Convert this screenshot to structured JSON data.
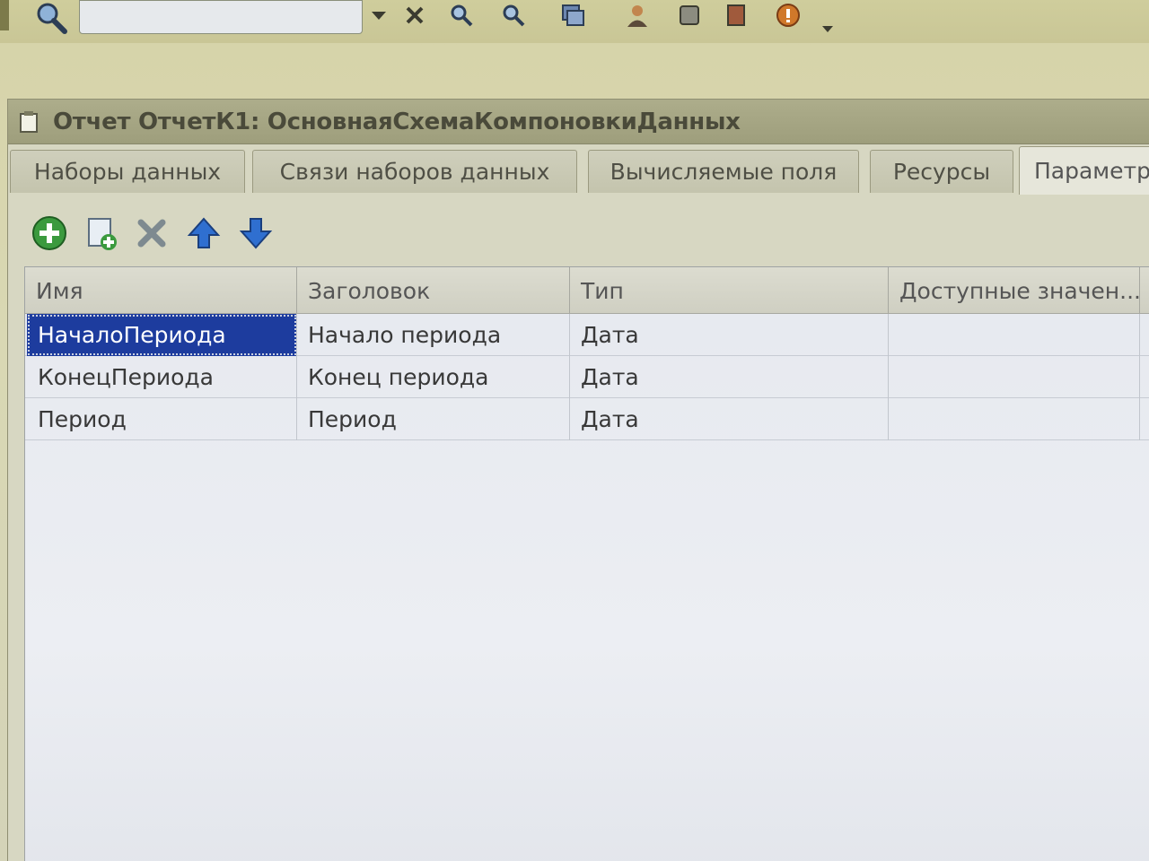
{
  "toolbar": {
    "search_value": "",
    "buttons": [
      "dropdown-arrow",
      "clear",
      "find-next",
      "find-previous",
      "windows",
      "user",
      "help-topics",
      "book",
      "info",
      "more"
    ]
  },
  "window": {
    "title": "Отчет ОтчетК1: ОсновнаяСхемаКомпоновкиДанных"
  },
  "tabs": [
    {
      "label": "Наборы данных"
    },
    {
      "label": "Связи наборов данных"
    },
    {
      "label": "Вычисляемые поля"
    },
    {
      "label": "Ресурсы"
    },
    {
      "label": "Параметры"
    }
  ],
  "active_tab": 4,
  "commands": [
    "add",
    "copy",
    "delete",
    "move-up",
    "move-down"
  ],
  "table": {
    "columns": [
      "Имя",
      "Заголовок",
      "Тип",
      "Доступные значен..."
    ],
    "rows": [
      {
        "name": "НачалоПериода",
        "title": "Начало периода",
        "type": "Дата",
        "values": ""
      },
      {
        "name": "КонецПериода",
        "title": "Конец периода",
        "type": "Дата",
        "values": ""
      },
      {
        "name": "Период",
        "title": "Период",
        "type": "Дата",
        "values": ""
      }
    ],
    "selected_row": 0
  },
  "colors": {
    "selection": "#1d3c9e",
    "add_green": "#3b9a3e",
    "arrow_blue": "#2f6fd0"
  }
}
